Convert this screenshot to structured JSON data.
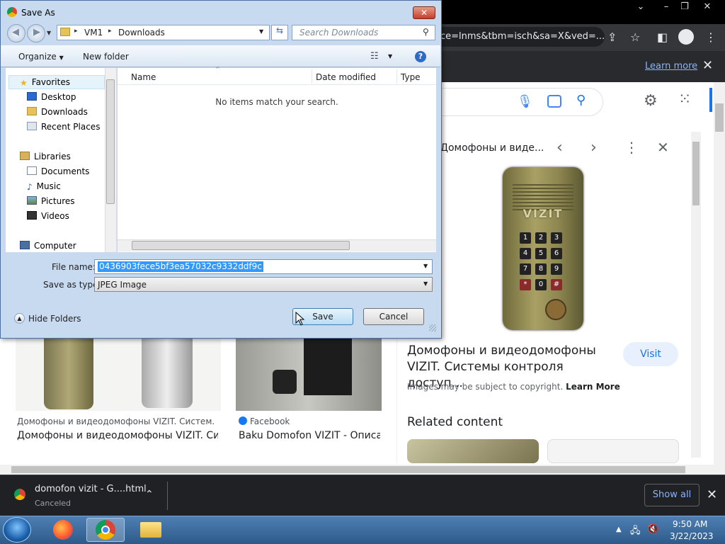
{
  "browser": {
    "url_fragment": "ce=lnms&tbm=isch&sa=X&ved=...",
    "infobar": {
      "link": "Learn more"
    },
    "panel": {
      "source_title": "Домофоны и виде...",
      "result_title": "Домофоны и видеодомофоны VIZIT. Системы контроля доступ...",
      "visit_label": "Visit",
      "copyright_text": "Images may be subject to copyright.",
      "copyright_link": "Learn More",
      "related_heading": "Related content",
      "intercom_logo": "VIZIT",
      "keypad": [
        "1",
        "2",
        "3",
        "4",
        "5",
        "6",
        "7",
        "8",
        "9",
        "*",
        "0",
        "#"
      ]
    },
    "grid": [
      {
        "source": "Домофоны и видеодомофоны VIZIT. Систем...",
        "title": "Домофоны и видеодомофоны VIZIT. Сис..."
      },
      {
        "source": "Facebook",
        "title": "Baku Domofon VIZIT - Описа..."
      }
    ]
  },
  "downloads": {
    "item_name": "domofon vizit - G....html",
    "item_status": "Canceled",
    "show_all": "Show all"
  },
  "taskbar": {
    "time": "9:50 AM",
    "date": "3/22/2023"
  },
  "dialog": {
    "title": "Save As",
    "path": [
      "VM1",
      "Downloads"
    ],
    "search_placeholder": "Search Downloads",
    "toolbar": {
      "organize": "Organize",
      "new_folder": "New folder"
    },
    "nav": {
      "favorites": "Favorites",
      "favorites_items": [
        "Desktop",
        "Downloads",
        "Recent Places"
      ],
      "libraries": "Libraries",
      "libraries_items": [
        "Documents",
        "Music",
        "Pictures",
        "Videos"
      ],
      "computer": "Computer"
    },
    "columns": [
      "Name",
      "Date modified",
      "Type"
    ],
    "empty_message": "No items match your search.",
    "file_name_label": "File name:",
    "file_name_value": "0436903fece5bf3ea57032c9332ddf9c",
    "save_as_type_label": "Save as type:",
    "save_as_type_value": "JPEG Image",
    "hide_folders": "Hide Folders",
    "save": "Save",
    "cancel": "Cancel"
  },
  "colors": {
    "chrome_dark": "#35363a",
    "link_blue": "#8ab4f8",
    "win7_frame": "#c8daf0",
    "selection": "#3399ff"
  }
}
